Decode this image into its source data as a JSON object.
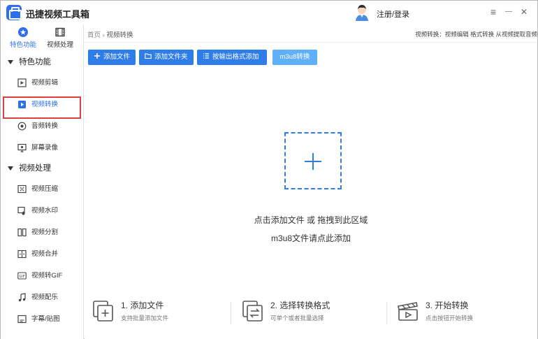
{
  "app": {
    "title": "迅捷视频工具箱",
    "login_label": "注册/登录"
  },
  "window_controls": {
    "menu": "≡",
    "minimize": "—",
    "close": "✕"
  },
  "sidebar": {
    "top_tabs": [
      {
        "label": "特色功能",
        "icon": "star-icon",
        "active": true
      },
      {
        "label": "视频处理",
        "icon": "film-icon",
        "active": false
      }
    ],
    "sections": [
      {
        "title": "特色功能",
        "items": [
          {
            "label": "视频剪辑",
            "icon": "video-edit-icon"
          },
          {
            "label": "视频转换",
            "icon": "video-convert-icon",
            "active": true
          },
          {
            "label": "音频转换",
            "icon": "audio-convert-icon"
          },
          {
            "label": "屏幕录像",
            "icon": "screen-record-icon"
          }
        ]
      },
      {
        "title": "视频处理",
        "items": [
          {
            "label": "视频压缩",
            "icon": "video-compress-icon"
          },
          {
            "label": "视频水印",
            "icon": "video-watermark-icon"
          },
          {
            "label": "视频分割",
            "icon": "video-split-icon"
          },
          {
            "label": "视频合并",
            "icon": "video-merge-icon"
          },
          {
            "label": "视频转GIF",
            "icon": "gif-icon"
          },
          {
            "label": "视频配乐",
            "icon": "music-icon"
          },
          {
            "label": "字幕/贴图",
            "icon": "subtitle-icon"
          }
        ]
      }
    ]
  },
  "breadcrumb": {
    "home": "首页",
    "separator": "›",
    "current": "视频转换"
  },
  "quick_links": "视频转换：视频编辑 格式转换 从视频提取音频",
  "toolbar": {
    "add_file": "添加文件",
    "add_folder": "添加文件夹",
    "add_by_format": "按输出格式添加",
    "m3u8": "m3u8转换"
  },
  "dropzone": {
    "hint_line1": "点击添加文件 或 拖拽到此区域",
    "hint_line2": "m3u8文件请点此添加"
  },
  "steps": [
    {
      "title": "1. 添加文件",
      "subtitle": "支持批量添加文件",
      "icon": "add-file-icon"
    },
    {
      "title": "2. 选择转换格式",
      "subtitle": "可单个或者批量选择",
      "icon": "format-select-icon"
    },
    {
      "title": "3. 开始转换",
      "subtitle": "点击按钮开始转换",
      "icon": "start-convert-icon"
    }
  ],
  "colors": {
    "accent": "#2f7de8",
    "accent_light": "#5fb0f6",
    "highlight": "#d94040"
  }
}
